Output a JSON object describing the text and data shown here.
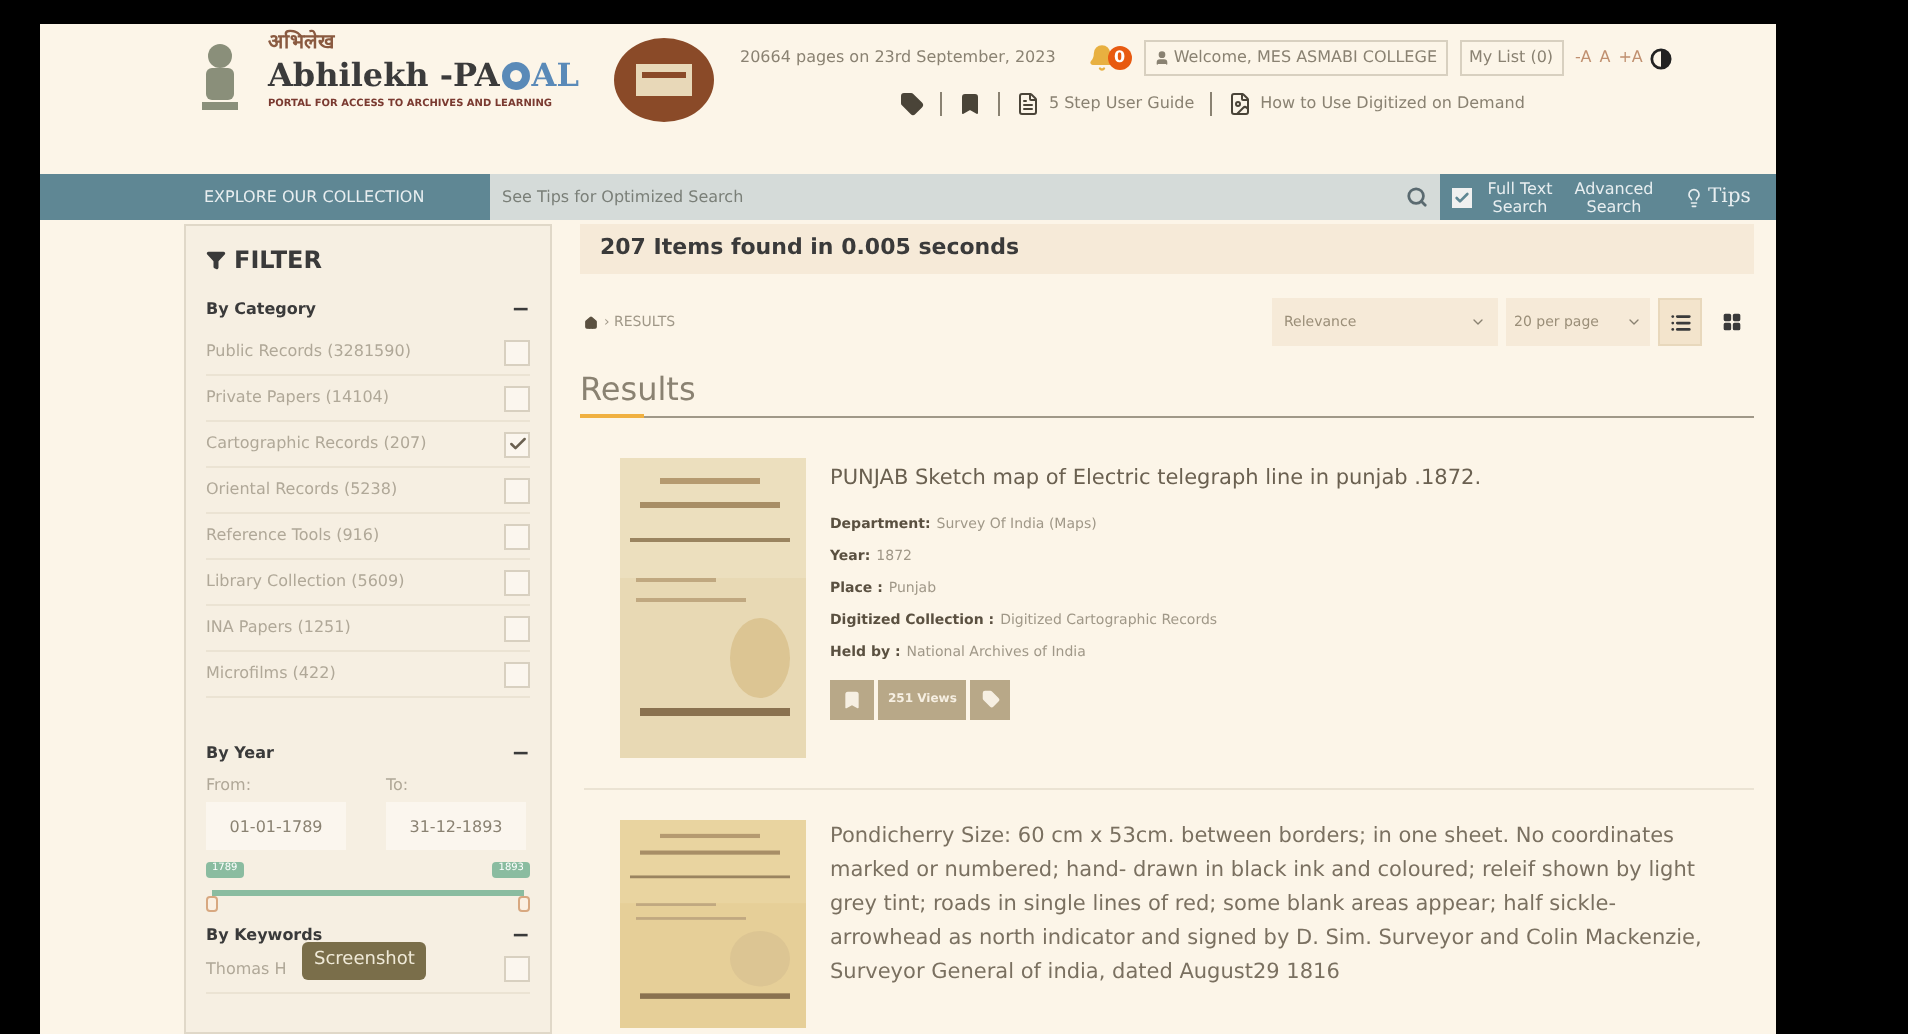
{
  "header": {
    "logo": {
      "hindi": "अभिलेख",
      "name_start": "Abhilekh -PA",
      "name_end": "AL",
      "tagline": "PORTAL FOR ACCESS TO ARCHIVES AND LEARNING"
    },
    "stats": "20664 pages on 23rd September, 2023",
    "notification_count": "0",
    "welcome": "Welcome, MES ASMABI COLLEGE",
    "my_list": "My List (0)",
    "font_sizes": [
      "-A",
      "A",
      "+A"
    ],
    "links": [
      {
        "kind": "tag"
      },
      {
        "kind": "bookmark"
      },
      {
        "kind": "pdf",
        "label": "5 Step User Guide"
      },
      {
        "kind": "doc",
        "label": "How to Use Digitized on Demand"
      }
    ]
  },
  "navbar": {
    "explore": "EXPLORE OUR COLLECTION",
    "search_placeholder": "See Tips for Optimized Search",
    "full_text": {
      "label": "Full Text Search",
      "checked": true
    },
    "advanced": "Advanced Search",
    "tips": "Tips"
  },
  "filter": {
    "title": "FILTER",
    "category": {
      "title": "By Category",
      "toggle": "−",
      "items": [
        {
          "label": "Public Records (3281590)",
          "checked": false
        },
        {
          "label": "Private Papers (14104)",
          "checked": false
        },
        {
          "label": "Cartographic Records (207)",
          "checked": true
        },
        {
          "label": "Oriental Records (5238)",
          "checked": false
        },
        {
          "label": "Reference Tools (916)",
          "checked": false
        },
        {
          "label": "Library Collection (5609)",
          "checked": false
        },
        {
          "label": "INA Papers (1251)",
          "checked": false
        },
        {
          "label": "Microfilms (422)",
          "checked": false
        }
      ]
    },
    "year": {
      "title": "By Year",
      "toggle": "−",
      "from_label": "From:",
      "to_label": "To:",
      "from": "01-01-1789",
      "to": "31-12-1893",
      "min_badge": "1789",
      "max_badge": "1893",
      "handles": [
        {
          "level": 0
        },
        {
          "level": 1
        }
      ]
    },
    "keywords": {
      "title": "By Keywords",
      "toggle": "−",
      "items": [
        {
          "label": "Thomas H",
          "checked": false
        }
      ]
    },
    "tooltip": "Screenshot"
  },
  "results": {
    "summary": "207 Items found in 0.005 seconds",
    "breadcrumb": "› RESULTS",
    "sort": "Relevance",
    "per_page": "20 per page",
    "views": [
      {
        "kind": "list",
        "selected": true
      },
      {
        "kind": "grid",
        "selected": false
      }
    ],
    "heading": "Results",
    "items": [
      {
        "kind": "picture",
        "title": "PUNJAB Sketch map of Electric telegraph line in punjab .1872.",
        "fields": [
          {
            "label": "Department:",
            "value": "Survey Of India (Maps)"
          },
          {
            "label": "Year:",
            "value": "1872"
          },
          {
            "label": "Place :",
            "value": "Punjab"
          },
          {
            "label": "Digitized Collection :",
            "value": "Digitized Cartographic Records"
          },
          {
            "label": "Held by :",
            "value": "National Archives of India"
          }
        ],
        "views": "251 Views"
      },
      {
        "kind": "picture",
        "title": "Pondicherry Size: 60 cm x 53cm. between borders; in one sheet. No coordinates marked or numbered; hand- drawn in black ink and coloured; releif shown by light grey tint; roads in single lines of red; some blank areas appear; half sickle- arrowhead as north indicator and signed by D. Sim. Surveyor and Colin Mackenzie, Surveyor General of india, dated August29 1816"
      }
    ]
  }
}
